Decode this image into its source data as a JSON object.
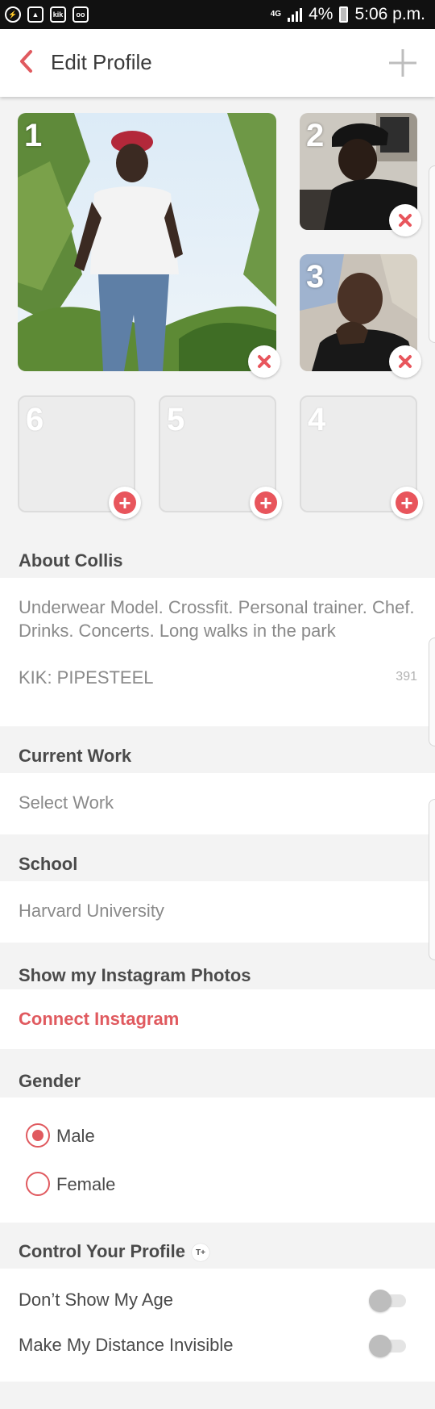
{
  "status_bar": {
    "left_icons": [
      "messenger-icon",
      "image-icon",
      "kik-icon",
      "voicemail-icon"
    ],
    "network": "4G",
    "battery": "4%",
    "time": "5:06 p.m."
  },
  "header": {
    "title": "Edit Profile"
  },
  "photos": {
    "slots": [
      {
        "number": "1",
        "has_photo": true
      },
      {
        "number": "2",
        "has_photo": true
      },
      {
        "number": "3",
        "has_photo": true
      },
      {
        "number": "6",
        "has_photo": false
      },
      {
        "number": "5",
        "has_photo": false
      },
      {
        "number": "4",
        "has_photo": false
      }
    ]
  },
  "about": {
    "title": "About Collis",
    "text": "Underwear Model. Crossfit. Personal trainer. Chef. Drinks.  Concerts. Long walks in the park\n\nKIK: PIPESTEEL",
    "remaining": "391"
  },
  "work": {
    "title": "Current Work",
    "value": "Select Work"
  },
  "school": {
    "title": "School",
    "value": "Harvard University"
  },
  "instagram": {
    "title": "Show my Instagram Photos",
    "link": "Connect Instagram"
  },
  "gender": {
    "title": "Gender",
    "options": [
      "Male",
      "Female"
    ],
    "selected": "Male"
  },
  "control": {
    "title": "Control Your Profile",
    "badge": "T+",
    "rows": [
      {
        "label": "Don’t Show My Age",
        "on": false
      },
      {
        "label": "Make My Distance Invisible",
        "on": false
      }
    ]
  },
  "colors": {
    "accent": "#e05a5f",
    "background": "#f3f3f3"
  }
}
